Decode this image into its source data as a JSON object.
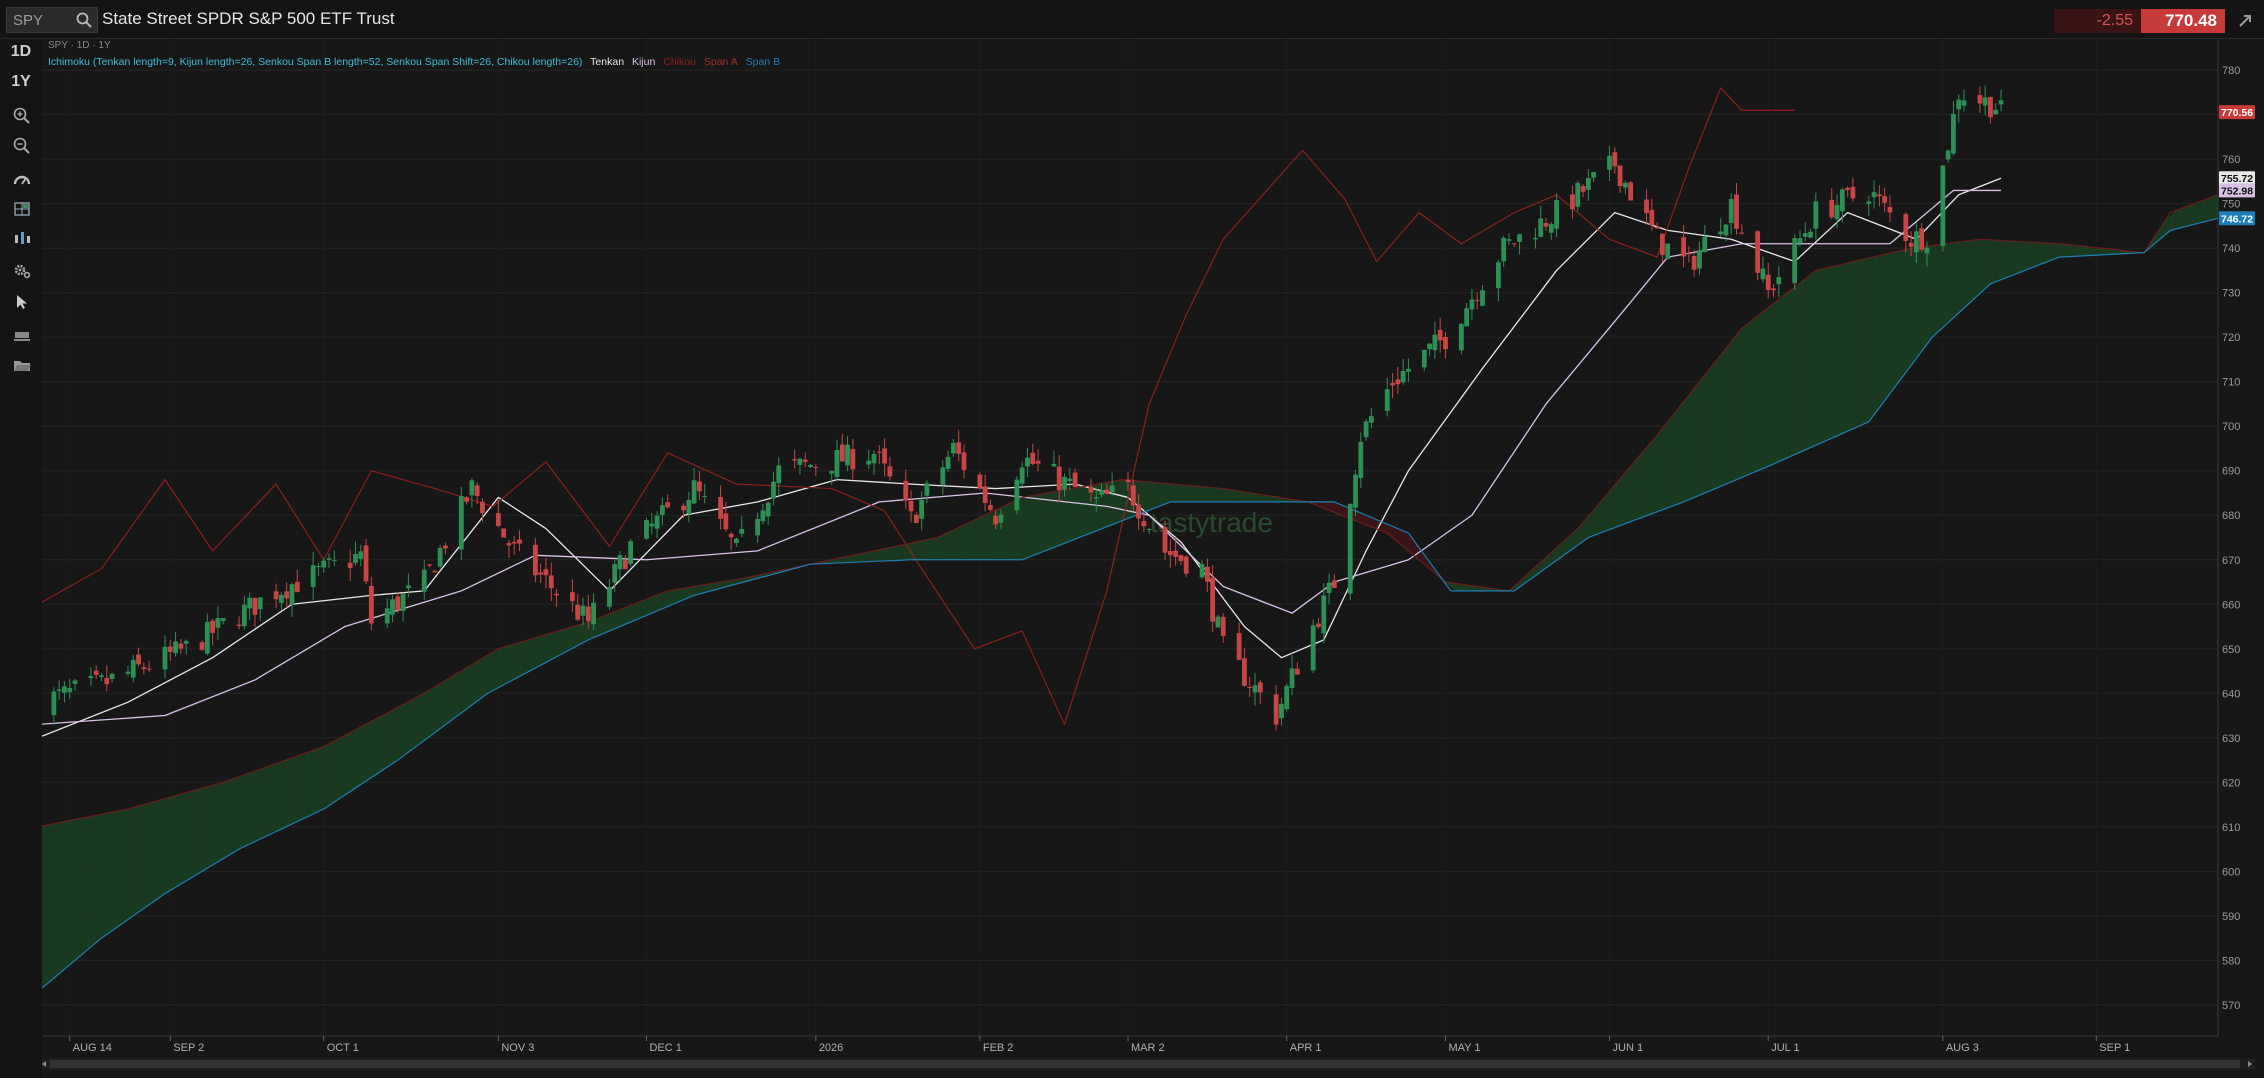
{
  "header": {
    "symbol_input_value": "SPY",
    "title": "State Street SPDR S&P 500 ETF Trust",
    "change": "-2.55",
    "price": "770.48"
  },
  "sidebar": {
    "timeframes": [
      "1D",
      "1Y"
    ],
    "tools": [
      "zoom-in-icon",
      "zoom-out-icon",
      "gauge-icon",
      "grid-icon",
      "bar-style-icon",
      "settings-icon",
      "cursor-icon",
      "drawing-icon",
      "folder-icon"
    ]
  },
  "chart_meta": {
    "legend_line": "SPY · 1D · 1Y",
    "indicator": "Ichimoku (Tenkan length=9, Kijun length=26, Senkou Span B length=52, Senkou Span Shift=26, Chikou length=26)",
    "tenkan_label": "Tenkan",
    "kijun_label": "Kijun",
    "chikou_label": "Chikou",
    "spana_label": "Span A",
    "spanb_label": "Span B",
    "watermark": "tastytrade"
  },
  "colors": {
    "up": "#2e8f55",
    "down": "#c94545",
    "tenkan": "#e8e8e8",
    "kijun": "#d7c2e6",
    "chikou": "#8f1f1f",
    "spanA": "#6b1d1d",
    "spanB": "#1e7fb8",
    "cloud_bull": "#1a3a1f",
    "cloud_bear": "#3a1518",
    "legend_indicator": "#3bbfd8"
  },
  "chart_data": {
    "type": "candlestick",
    "title": "SPY · 1D · 1Y",
    "ylim": [
      563,
      787
    ],
    "y_ticks": [
      570,
      580,
      590,
      600,
      610,
      620,
      630,
      640,
      650,
      660,
      670,
      680,
      690,
      700,
      710,
      720,
      730,
      740,
      750,
      760,
      770,
      780
    ],
    "x_start": "2025-08-08",
    "x_end": "2026-09-24",
    "x_ticks": [
      {
        "date": "2025-08-14",
        "label": "AUG 14"
      },
      {
        "date": "2025-09-02",
        "label": "SEP 2"
      },
      {
        "date": "2025-10-01",
        "label": "OCT 1"
      },
      {
        "date": "2025-11-03",
        "label": "NOV 3"
      },
      {
        "date": "2025-12-01",
        "label": "DEC 1"
      },
      {
        "date": "2026-01-02",
        "label": "2026"
      },
      {
        "date": "2026-02-02",
        "label": "FEB 2"
      },
      {
        "date": "2026-03-02",
        "label": "MAR 2"
      },
      {
        "date": "2026-04-01",
        "label": "APR 1"
      },
      {
        "date": "2026-05-01",
        "label": "MAY 1"
      },
      {
        "date": "2026-06-01",
        "label": "JUN 1"
      },
      {
        "date": "2026-07-01",
        "label": "JUL 1"
      },
      {
        "date": "2026-08-03",
        "label": "AUG 3"
      },
      {
        "date": "2026-09-01",
        "label": "SEP 1"
      }
    ],
    "price_anchors": [
      {
        "date": "2025-08-08",
        "close": 638
      },
      {
        "date": "2025-08-20",
        "close": 642
      },
      {
        "date": "2025-09-05",
        "close": 650
      },
      {
        "date": "2025-09-22",
        "close": 663
      },
      {
        "date": "2025-10-08",
        "close": 671
      },
      {
        "date": "2025-10-10",
        "close": 656
      },
      {
        "date": "2025-10-20",
        "close": 665
      },
      {
        "date": "2025-10-29",
        "close": 686
      },
      {
        "date": "2025-11-06",
        "close": 672
      },
      {
        "date": "2025-11-20",
        "close": 656
      },
      {
        "date": "2025-11-28",
        "close": 673
      },
      {
        "date": "2025-12-10",
        "close": 686
      },
      {
        "date": "2025-12-18",
        "close": 672
      },
      {
        "date": "2025-12-26",
        "close": 690
      },
      {
        "date": "2026-01-13",
        "close": 694
      },
      {
        "date": "2026-01-20",
        "close": 679
      },
      {
        "date": "2026-01-28",
        "close": 695
      },
      {
        "date": "2026-02-05",
        "close": 680
      },
      {
        "date": "2026-02-10",
        "close": 693
      },
      {
        "date": "2026-02-24",
        "close": 683
      },
      {
        "date": "2026-03-02",
        "close": 686
      },
      {
        "date": "2026-03-09",
        "close": 672
      },
      {
        "date": "2026-03-16",
        "close": 668
      },
      {
        "date": "2026-03-20",
        "close": 650
      },
      {
        "date": "2026-03-30",
        "close": 635
      },
      {
        "date": "2026-04-06",
        "close": 655
      },
      {
        "date": "2026-04-10",
        "close": 665
      },
      {
        "date": "2026-04-15",
        "close": 698
      },
      {
        "date": "2026-04-21",
        "close": 710
      },
      {
        "date": "2026-05-01",
        "close": 720
      },
      {
        "date": "2026-05-12",
        "close": 740
      },
      {
        "date": "2026-05-22",
        "close": 748
      },
      {
        "date": "2026-06-02",
        "close": 759
      },
      {
        "date": "2026-06-10",
        "close": 742
      },
      {
        "date": "2026-06-16",
        "close": 736
      },
      {
        "date": "2026-06-24",
        "close": 750
      },
      {
        "date": "2026-07-01",
        "close": 730
      },
      {
        "date": "2026-07-10",
        "close": 748
      },
      {
        "date": "2026-07-20",
        "close": 753
      },
      {
        "date": "2026-07-28",
        "close": 742
      },
      {
        "date": "2026-07-31",
        "close": 743
      },
      {
        "date": "2026-08-03",
        "close": 758
      },
      {
        "date": "2026-08-06",
        "close": 775
      },
      {
        "date": "2026-08-13",
        "close": 772
      },
      {
        "date": "2026-08-14",
        "close": 770.48
      }
    ],
    "series": [
      {
        "name": "Tenkan",
        "points": [
          {
            "date": "2025-08-08",
            "value": 630
          },
          {
            "date": "2025-08-25",
            "value": 638
          },
          {
            "date": "2025-09-10",
            "value": 648
          },
          {
            "date": "2025-09-25",
            "value": 660
          },
          {
            "date": "2025-10-10",
            "value": 662
          },
          {
            "date": "2025-10-20",
            "value": 663
          },
          {
            "date": "2025-11-03",
            "value": 684
          },
          {
            "date": "2025-11-12",
            "value": 677
          },
          {
            "date": "2025-11-24",
            "value": 663
          },
          {
            "date": "2025-12-08",
            "value": 680
          },
          {
            "date": "2025-12-22",
            "value": 683
          },
          {
            "date": "2026-01-06",
            "value": 688
          },
          {
            "date": "2026-01-20",
            "value": 687
          },
          {
            "date": "2026-02-05",
            "value": 686
          },
          {
            "date": "2026-02-20",
            "value": 687
          },
          {
            "date": "2026-03-02",
            "value": 684
          },
          {
            "date": "2026-03-12",
            "value": 674
          },
          {
            "date": "2026-03-24",
            "value": 655
          },
          {
            "date": "2026-03-31",
            "value": 648
          },
          {
            "date": "2026-04-08",
            "value": 652
          },
          {
            "date": "2026-04-16",
            "value": 672
          },
          {
            "date": "2026-04-24",
            "value": 690
          },
          {
            "date": "2026-05-08",
            "value": 713
          },
          {
            "date": "2026-05-22",
            "value": 735
          },
          {
            "date": "2026-06-02",
            "value": 748
          },
          {
            "date": "2026-06-12",
            "value": 744
          },
          {
            "date": "2026-06-24",
            "value": 742
          },
          {
            "date": "2026-07-06",
            "value": 737
          },
          {
            "date": "2026-07-16",
            "value": 748
          },
          {
            "date": "2026-07-29",
            "value": 742
          },
          {
            "date": "2026-08-06",
            "value": 752
          },
          {
            "date": "2026-08-14",
            "value": 755.72
          }
        ]
      },
      {
        "name": "Kijun",
        "points": [
          {
            "date": "2025-08-08",
            "value": 633
          },
          {
            "date": "2025-09-01",
            "value": 635
          },
          {
            "date": "2025-09-18",
            "value": 643
          },
          {
            "date": "2025-10-05",
            "value": 655
          },
          {
            "date": "2025-10-27",
            "value": 663
          },
          {
            "date": "2025-11-10",
            "value": 671
          },
          {
            "date": "2025-12-01",
            "value": 670
          },
          {
            "date": "2025-12-22",
            "value": 672
          },
          {
            "date": "2026-01-14",
            "value": 683
          },
          {
            "date": "2026-02-03",
            "value": 685
          },
          {
            "date": "2026-02-26",
            "value": 682
          },
          {
            "date": "2026-03-06",
            "value": 680
          },
          {
            "date": "2026-03-20",
            "value": 664
          },
          {
            "date": "2026-04-02",
            "value": 658
          },
          {
            "date": "2026-04-10",
            "value": 665
          },
          {
            "date": "2026-04-24",
            "value": 670
          },
          {
            "date": "2026-05-06",
            "value": 680
          },
          {
            "date": "2026-05-20",
            "value": 705
          },
          {
            "date": "2026-06-03",
            "value": 725
          },
          {
            "date": "2026-06-12",
            "value": 738
          },
          {
            "date": "2026-06-26",
            "value": 741
          },
          {
            "date": "2026-07-10",
            "value": 741
          },
          {
            "date": "2026-07-24",
            "value": 741
          },
          {
            "date": "2026-08-05",
            "value": 752.98
          },
          {
            "date": "2026-08-14",
            "value": 752.98
          }
        ]
      },
      {
        "name": "Chikou",
        "points": [
          {
            "date": "2025-08-08",
            "value": 660
          },
          {
            "date": "2025-08-20",
            "value": 668
          },
          {
            "date": "2025-09-01",
            "value": 688
          },
          {
            "date": "2025-09-10",
            "value": 672
          },
          {
            "date": "2025-09-22",
            "value": 687
          },
          {
            "date": "2025-10-01",
            "value": 670
          },
          {
            "date": "2025-10-10",
            "value": 690
          },
          {
            "date": "2025-10-22",
            "value": 686
          },
          {
            "date": "2025-11-02",
            "value": 682
          },
          {
            "date": "2025-11-12",
            "value": 692
          },
          {
            "date": "2025-11-24",
            "value": 673
          },
          {
            "date": "2025-12-05",
            "value": 694
          },
          {
            "date": "2025-12-18",
            "value": 687
          },
          {
            "date": "2026-01-05",
            "value": 686
          },
          {
            "date": "2026-01-15",
            "value": 681
          },
          {
            "date": "2026-01-22",
            "value": 668
          },
          {
            "date": "2026-02-01",
            "value": 650
          },
          {
            "date": "2026-02-10",
            "value": 654
          },
          {
            "date": "2026-02-18",
            "value": 633
          },
          {
            "date": "2026-02-26",
            "value": 663
          },
          {
            "date": "2026-03-06",
            "value": 705
          },
          {
            "date": "2026-03-13",
            "value": 725
          },
          {
            "date": "2026-03-20",
            "value": 742
          },
          {
            "date": "2026-03-26",
            "value": 750
          },
          {
            "date": "2026-04-04",
            "value": 762
          },
          {
            "date": "2026-04-12",
            "value": 751
          },
          {
            "date": "2026-04-18",
            "value": 737
          },
          {
            "date": "2026-04-26",
            "value": 748
          },
          {
            "date": "2026-05-04",
            "value": 741
          },
          {
            "date": "2026-05-14",
            "value": 748
          },
          {
            "date": "2026-05-22",
            "value": 752
          },
          {
            "date": "2026-06-01",
            "value": 742
          },
          {
            "date": "2026-06-10",
            "value": 738
          },
          {
            "date": "2026-06-16",
            "value": 758
          },
          {
            "date": "2026-06-22",
            "value": 776
          },
          {
            "date": "2026-06-26",
            "value": 771
          },
          {
            "date": "2026-07-06",
            "value": 771
          }
        ]
      },
      {
        "name": "Span A",
        "points": [
          {
            "date": "2025-08-08",
            "value": 610
          },
          {
            "date": "2025-08-25",
            "value": 614
          },
          {
            "date": "2025-09-12",
            "value": 620
          },
          {
            "date": "2025-10-01",
            "value": 628
          },
          {
            "date": "2025-10-20",
            "value": 640
          },
          {
            "date": "2025-11-03",
            "value": 650
          },
          {
            "date": "2025-11-20",
            "value": 656
          },
          {
            "date": "2025-12-05",
            "value": 663
          },
          {
            "date": "2025-12-20",
            "value": 666
          },
          {
            "date": "2026-01-05",
            "value": 670
          },
          {
            "date": "2026-01-25",
            "value": 675
          },
          {
            "date": "2026-02-10",
            "value": 684
          },
          {
            "date": "2026-03-01",
            "value": 688
          },
          {
            "date": "2026-03-20",
            "value": 686
          },
          {
            "date": "2026-04-05",
            "value": 683
          },
          {
            "date": "2026-04-20",
            "value": 676
          },
          {
            "date": "2026-05-01",
            "value": 665
          },
          {
            "date": "2026-05-13",
            "value": 663
          },
          {
            "date": "2026-05-26",
            "value": 677
          },
          {
            "date": "2026-06-10",
            "value": 698
          },
          {
            "date": "2026-06-26",
            "value": 722
          },
          {
            "date": "2026-07-10",
            "value": 735
          },
          {
            "date": "2026-07-28",
            "value": 740
          },
          {
            "date": "2026-08-10",
            "value": 742
          },
          {
            "date": "2026-08-25",
            "value": 741
          },
          {
            "date": "2026-09-10",
            "value": 739
          },
          {
            "date": "2026-09-15",
            "value": 748
          },
          {
            "date": "2026-09-24",
            "value": 752
          }
        ]
      },
      {
        "name": "Span B",
        "points": [
          {
            "date": "2025-08-08",
            "value": 573
          },
          {
            "date": "2025-08-20",
            "value": 585
          },
          {
            "date": "2025-09-01",
            "value": 595
          },
          {
            "date": "2025-09-15",
            "value": 605
          },
          {
            "date": "2025-10-01",
            "value": 614
          },
          {
            "date": "2025-10-15",
            "value": 625
          },
          {
            "date": "2025-11-01",
            "value": 640
          },
          {
            "date": "2025-11-20",
            "value": 652
          },
          {
            "date": "2025-12-10",
            "value": 662
          },
          {
            "date": "2026-01-01",
            "value": 669
          },
          {
            "date": "2026-01-20",
            "value": 670
          },
          {
            "date": "2026-02-10",
            "value": 670
          },
          {
            "date": "2026-03-10",
            "value": 683
          },
          {
            "date": "2026-04-10",
            "value": 683
          },
          {
            "date": "2026-04-24",
            "value": 676
          },
          {
            "date": "2026-05-02",
            "value": 663
          },
          {
            "date": "2026-05-14",
            "value": 663
          },
          {
            "date": "2026-05-28",
            "value": 675
          },
          {
            "date": "2026-06-15",
            "value": 683
          },
          {
            "date": "2026-07-01",
            "value": 691
          },
          {
            "date": "2026-07-20",
            "value": 701
          },
          {
            "date": "2026-08-01",
            "value": 720
          },
          {
            "date": "2026-08-12",
            "value": 732
          },
          {
            "date": "2026-08-25",
            "value": 738
          },
          {
            "date": "2026-09-10",
            "value": 739
          },
          {
            "date": "2026-09-15",
            "value": 744
          },
          {
            "date": "2026-09-24",
            "value": 746.72
          }
        ]
      }
    ],
    "price_labels": [
      {
        "value": 770.56,
        "label": "770.56",
        "bg": "#c73a3a",
        "fg": "#ffffff"
      },
      {
        "value": 755.72,
        "label": "755.72",
        "bg": "#e8e8e8",
        "fg": "#111111"
      },
      {
        "value": 752.98,
        "label": "752.98",
        "bg": "#d7c2e6",
        "fg": "#111111"
      },
      {
        "value": 746.72,
        "label": "746.72",
        "bg": "#1e7fb8",
        "fg": "#ffffff"
      }
    ],
    "grid": true
  }
}
